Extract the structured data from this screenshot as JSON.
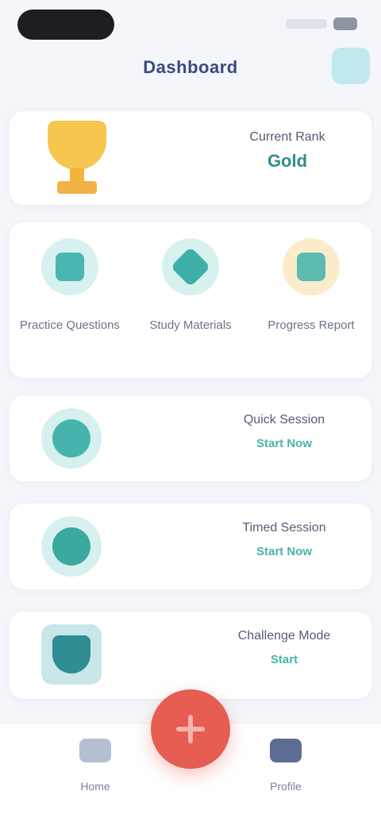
{
  "header": {
    "title": "Dashboard"
  },
  "rank": {
    "label": "Current Rank",
    "value": "Gold"
  },
  "features": [
    {
      "label": "Practice Questions",
      "icon": "practice-icon"
    },
    {
      "label": "Study Materials",
      "icon": "study-icon"
    },
    {
      "label": "Progress Report",
      "icon": "progress-icon"
    }
  ],
  "modes": [
    {
      "title": "Quick Session",
      "subtitle": "Start Now",
      "icon": "quick-session-icon"
    },
    {
      "title": "Timed Session",
      "subtitle": "Start Now",
      "icon": "timed-session-icon"
    },
    {
      "title": "Challenge Mode",
      "subtitle": "Start",
      "icon": "challenge-icon"
    }
  ],
  "nav": {
    "left_label": "Home",
    "right_label": "Profile"
  },
  "colors": {
    "accent": "#49b3a9",
    "fab": "#e65d52",
    "trophy": "#f6c64e"
  }
}
